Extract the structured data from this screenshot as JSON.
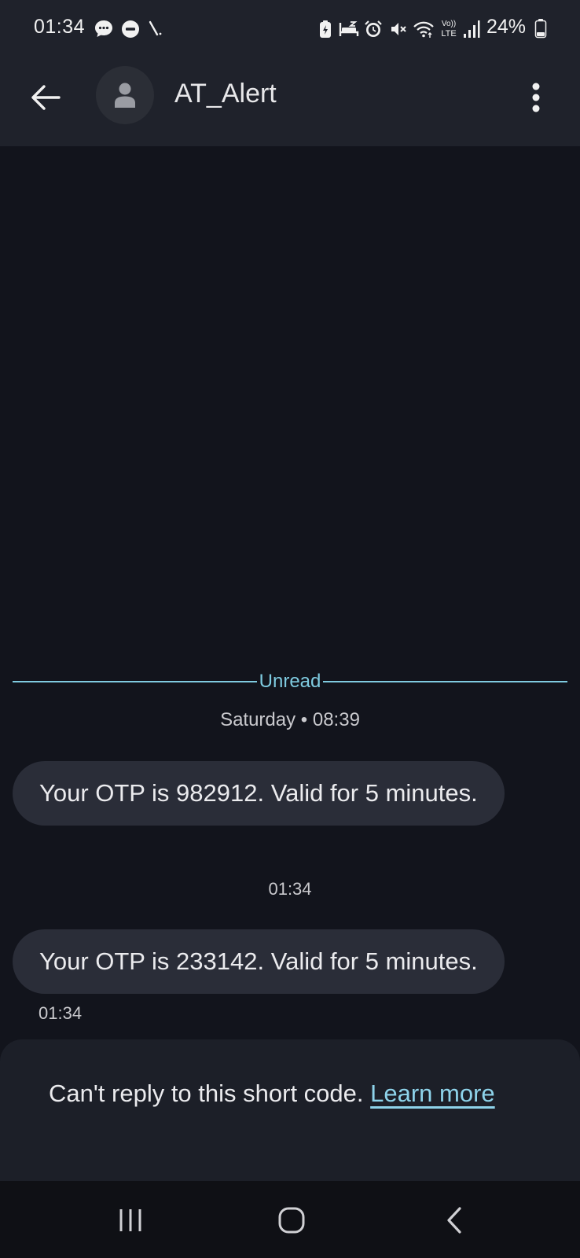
{
  "status_bar": {
    "time": "01:34",
    "battery_percent": "24%",
    "icons": [
      "message-notification-icon",
      "do-not-disturb-icon",
      "missed-call-icon",
      "battery-saver-icon",
      "sleep-mode-icon",
      "alarm-icon",
      "vibrate-mute-icon",
      "wifi-icon",
      "volte-icon",
      "signal-icon",
      "battery-icon"
    ],
    "volte_label": "Vo))\nLTE"
  },
  "app_bar": {
    "back_icon": "arrow-back-icon",
    "avatar_icon": "person-icon",
    "contact_name": "AT_Alert",
    "more_icon": "more-vert-icon"
  },
  "conversation": {
    "unread_label": "Unread",
    "date_stamp": "Saturday • 08:39",
    "messages": [
      {
        "text": "Your OTP is 982912. Valid for 5 minutes."
      },
      {
        "time_header": "01:34",
        "text": "Your OTP is 233142. Valid for 5 minutes.",
        "time": "01:34"
      }
    ]
  },
  "reply_panel": {
    "text": "Can't reply to this short code.",
    "link": "Learn more"
  },
  "nav_bar": {
    "icons": [
      "recent-apps-icon",
      "home-icon",
      "back-nav-icon"
    ]
  },
  "colors": {
    "background": "#12141c",
    "header": "#1f222b",
    "bubble": "#2a2d38",
    "accent": "#7fcbe0",
    "link": "#8ed3ea"
  }
}
